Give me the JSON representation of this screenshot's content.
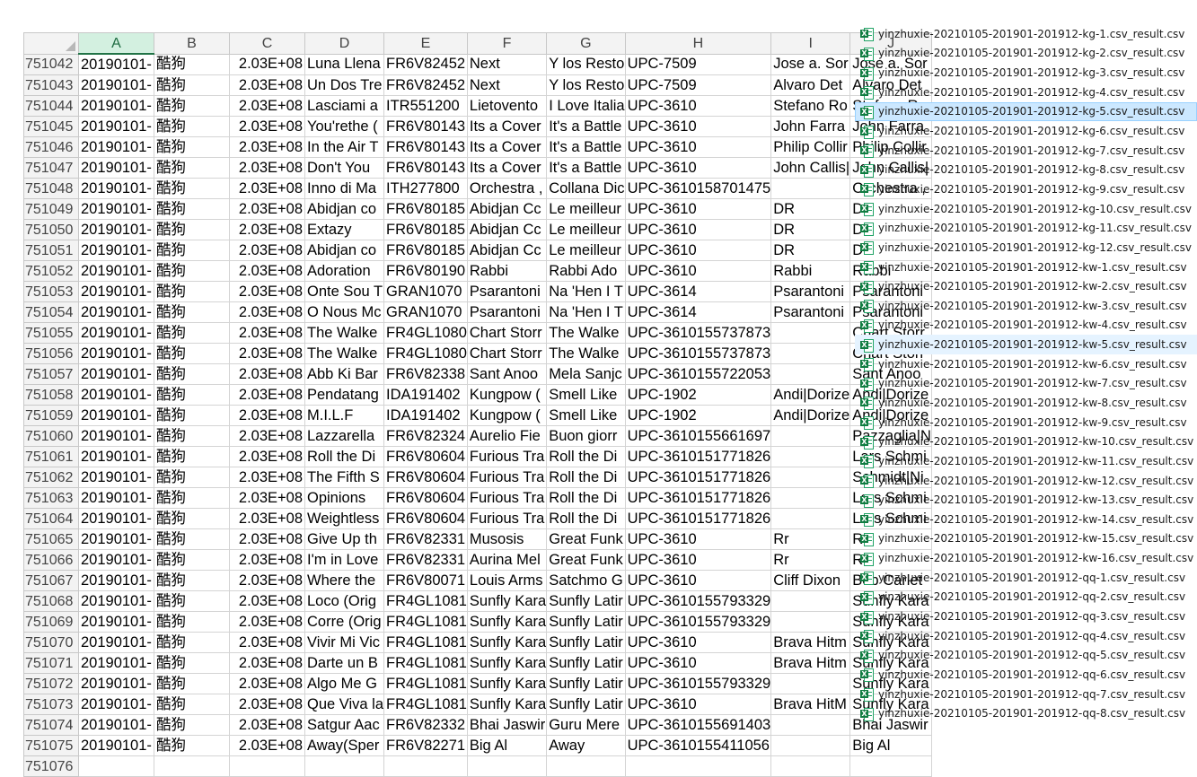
{
  "spreadsheet": {
    "columns": [
      "A",
      "B",
      "C",
      "D",
      "E",
      "F",
      "G",
      "H",
      "I",
      "J"
    ],
    "selected_column": "A",
    "rows": [
      {
        "n": "751042",
        "a": "20190101-",
        "b": "酷狗",
        "c": "2.03E+08",
        "d": "Luna Llena",
        "e": "FR6V82452",
        "f": "Next",
        "g": "Y los Resto",
        "h": "UPC-7509",
        "i": "Jose a. Sor",
        "j": "Jose a. Sor"
      },
      {
        "n": "751043",
        "a": "20190101-",
        "b": "酷狗",
        "c": "2.03E+08",
        "d": "Un Dos Tre",
        "e": "FR6V82452",
        "f": "Next",
        "g": "Y los Resto",
        "h": "UPC-7509",
        "i": "Alvaro Det",
        "j": "Alvaro Det"
      },
      {
        "n": "751044",
        "a": "20190101-",
        "b": "酷狗",
        "c": "2.03E+08",
        "d": "Lasciami a",
        "e": "ITR551200",
        "f": "Lietovento",
        "g": "I Love Italia",
        "h": "UPC-3610",
        "i": "Stefano Ro",
        "j": "Stefano Ro"
      },
      {
        "n": "751045",
        "a": "20190101-",
        "b": "酷狗",
        "c": "2.03E+08",
        "d": "You'rethe (",
        "e": "FR6V80143",
        "f": "Its a Cover",
        "g": "It's a Battle",
        "h": "UPC-3610",
        "i": "John Farra",
        "j": "John Farra"
      },
      {
        "n": "751046",
        "a": "20190101-",
        "b": "酷狗",
        "c": "2.03E+08",
        "d": "In the Air T",
        "e": "FR6V80143",
        "f": "Its a Cover",
        "g": "It's a Battle",
        "h": "UPC-3610",
        "i": "Philip Collir",
        "j": "Philip Collir"
      },
      {
        "n": "751047",
        "a": "20190101-",
        "b": "酷狗",
        "c": "2.03E+08",
        "d": "Don't You",
        "e": "FR6V80143",
        "f": "Its a Cover",
        "g": "It's a Battle",
        "h": "UPC-3610",
        "i": "John Callis|",
        "j": "John Callis|"
      },
      {
        "n": "751048",
        "a": "20190101-",
        "b": "酷狗",
        "c": "2.03E+08",
        "d": "Inno di Ma",
        "e": "ITH277800",
        "f": "Orchestra ,",
        "g": "Collana Dic",
        "h": "UPC-3610158701475",
        "i": "",
        "j": "Orchestra ,"
      },
      {
        "n": "751049",
        "a": "20190101-",
        "b": "酷狗",
        "c": "2.03E+08",
        "d": "Abidjan co",
        "e": "FR6V80185",
        "f": "Abidjan Cc",
        "g": "Le meilleur",
        "h": "UPC-3610",
        "i": "DR",
        "j": "DR"
      },
      {
        "n": "751050",
        "a": "20190101-",
        "b": "酷狗",
        "c": "2.03E+08",
        "d": "Extazy",
        "e": "FR6V80185",
        "f": "Abidjan Cc",
        "g": "Le meilleur",
        "h": "UPC-3610",
        "i": "DR",
        "j": "DR"
      },
      {
        "n": "751051",
        "a": "20190101-",
        "b": "酷狗",
        "c": "2.03E+08",
        "d": "Abidjan co",
        "e": "FR6V80185",
        "f": "Abidjan Cc",
        "g": "Le meilleur",
        "h": "UPC-3610",
        "i": "DR",
        "j": "DR"
      },
      {
        "n": "751052",
        "a": "20190101-",
        "b": "酷狗",
        "c": "2.03E+08",
        "d": "Adoration",
        "e": "FR6V80190",
        "f": "Rabbi",
        "g": "Rabbi Ado",
        "h": "UPC-3610",
        "i": "Rabbi",
        "j": "Rabbi"
      },
      {
        "n": "751053",
        "a": "20190101-",
        "b": "酷狗",
        "c": "2.03E+08",
        "d": "Onte Sou T",
        "e": "GRAN1070",
        "f": "Psarantoni",
        "g": "Na 'Hen I T",
        "h": "UPC-3614",
        "i": "Psarantoni",
        "j": "Psarantoni"
      },
      {
        "n": "751054",
        "a": "20190101-",
        "b": "酷狗",
        "c": "2.03E+08",
        "d": "O Nous Mc",
        "e": "GRAN1070",
        "f": "Psarantoni",
        "g": "Na 'Hen I T",
        "h": "UPC-3614",
        "i": "Psarantoni",
        "j": "Psarantoni"
      },
      {
        "n": "751055",
        "a": "20190101-",
        "b": "酷狗",
        "c": "2.03E+08",
        "d": "The Walke",
        "e": "FR4GL1080",
        "f": "Chart Storr",
        "g": "The Walke",
        "h": "UPC-3610155737873",
        "i": "",
        "j": "Chart Storr"
      },
      {
        "n": "751056",
        "a": "20190101-",
        "b": "酷狗",
        "c": "2.03E+08",
        "d": "The Walke",
        "e": "FR4GL1080",
        "f": "Chart Storr",
        "g": "The Walke",
        "h": "UPC-3610155737873",
        "i": "",
        "j": "Chart Storr"
      },
      {
        "n": "751057",
        "a": "20190101-",
        "b": "酷狗",
        "c": "2.03E+08",
        "d": "Abb Ki Bar",
        "e": "FR6V82338",
        "f": "Sant Anoo",
        "g": "Mela Sanjc",
        "h": "UPC-3610155722053",
        "i": "",
        "j": "Sant Anoo"
      },
      {
        "n": "751058",
        "a": "20190101-",
        "b": "酷狗",
        "c": "2.03E+08",
        "d": "Pendatang",
        "e": "IDA191402",
        "f": "Kungpow (",
        "g": "Smell Like",
        "h": "UPC-1902",
        "i": "Andi|Dorize",
        "j": "Andi|Dorize"
      },
      {
        "n": "751059",
        "a": "20190101-",
        "b": "酷狗",
        "c": "2.03E+08",
        "d": "M.I.L.F",
        "e": "IDA191402",
        "f": "Kungpow (",
        "g": "Smell Like",
        "h": "UPC-1902",
        "i": "Andi|Dorize",
        "j": "Andi|Dorize"
      },
      {
        "n": "751060",
        "a": "20190101-",
        "b": "酷狗",
        "c": "2.03E+08",
        "d": "Lazzarella",
        "e": "FR6V82324",
        "f": "Aurelio Fie",
        "g": "Buon giorr",
        "h": "UPC-3610155661697",
        "i": "",
        "j": "Pazzaglia|N"
      },
      {
        "n": "751061",
        "a": "20190101-",
        "b": "酷狗",
        "c": "2.03E+08",
        "d": "Roll the Di",
        "e": "FR6V80604",
        "f": "Furious Tra",
        "g": "Roll the Di",
        "h": "UPC-3610151771826",
        "i": "",
        "j": "Lars Schmi"
      },
      {
        "n": "751062",
        "a": "20190101-",
        "b": "酷狗",
        "c": "2.03E+08",
        "d": "The Fifth S",
        "e": "FR6V80604",
        "f": "Furious Tra",
        "g": "Roll the Di",
        "h": "UPC-3610151771826",
        "i": "",
        "j": "Schmidt|Ni"
      },
      {
        "n": "751063",
        "a": "20190101-",
        "b": "酷狗",
        "c": "2.03E+08",
        "d": "Opinions",
        "e": "FR6V80604",
        "f": "Furious Tra",
        "g": "Roll the Di",
        "h": "UPC-3610151771826",
        "i": "",
        "j": "Lars Schmi"
      },
      {
        "n": "751064",
        "a": "20190101-",
        "b": "酷狗",
        "c": "2.03E+08",
        "d": "Weightless",
        "e": "FR6V80604",
        "f": "Furious Tra",
        "g": "Roll the Di",
        "h": "UPC-3610151771826",
        "i": "",
        "j": "Lars Schmi"
      },
      {
        "n": "751065",
        "a": "20190101-",
        "b": "酷狗",
        "c": "2.03E+08",
        "d": "Give Up th",
        "e": "FR6V82331",
        "f": "Musosis",
        "g": "Great Funk",
        "h": "UPC-3610",
        "i": "Rr",
        "j": "Rr"
      },
      {
        "n": "751066",
        "a": "20190101-",
        "b": "酷狗",
        "c": "2.03E+08",
        "d": "I'm in Love",
        "e": "FR6V82331",
        "f": "Aurina Mel",
        "g": "Great Funk",
        "h": "UPC-3610",
        "i": "Rr",
        "j": "Rr"
      },
      {
        "n": "751067",
        "a": "20190101-",
        "b": "酷狗",
        "c": "2.03E+08",
        "d": "Where the",
        "e": "FR6V80071",
        "f": "Louis Arms",
        "g": "Satchmo G",
        "h": "UPC-3610",
        "i": "Cliff Dixon",
        "j": "Bob Carlet"
      },
      {
        "n": "751068",
        "a": "20190101-",
        "b": "酷狗",
        "c": "2.03E+08",
        "d": "Loco (Orig",
        "e": "FR4GL1081",
        "f": "Sunfly Kara",
        "g": "Sunfly Latir",
        "h": "UPC-3610155793329",
        "i": "",
        "j": "Sunfly Kara"
      },
      {
        "n": "751069",
        "a": "20190101-",
        "b": "酷狗",
        "c": "2.03E+08",
        "d": "Corre (Orig",
        "e": "FR4GL1081",
        "f": "Sunfly Kara",
        "g": "Sunfly Latir",
        "h": "UPC-3610155793329",
        "i": "",
        "j": "Sunfly Kara"
      },
      {
        "n": "751070",
        "a": "20190101-",
        "b": "酷狗",
        "c": "2.03E+08",
        "d": "Vivir Mi Vic",
        "e": "FR4GL1081",
        "f": "Sunfly Kara",
        "g": "Sunfly Latir",
        "h": "UPC-3610",
        "i": "Brava Hitm",
        "j": "Sunfly Kara"
      },
      {
        "n": "751071",
        "a": "20190101-",
        "b": "酷狗",
        "c": "2.03E+08",
        "d": "Darte un B",
        "e": "FR4GL1081",
        "f": "Sunfly Kara",
        "g": "Sunfly Latir",
        "h": "UPC-3610",
        "i": "Brava Hitm",
        "j": "Sunfly Kara"
      },
      {
        "n": "751072",
        "a": "20190101-",
        "b": "酷狗",
        "c": "2.03E+08",
        "d": "Algo Me G",
        "e": "FR4GL1081",
        "f": "Sunfly Kara",
        "g": "Sunfly Latir",
        "h": "UPC-3610155793329",
        "i": "",
        "j": "Sunfly Kara"
      },
      {
        "n": "751073",
        "a": "20190101-",
        "b": "酷狗",
        "c": "2.03E+08",
        "d": "Que Viva la",
        "e": "FR4GL1081",
        "f": "Sunfly Kara",
        "g": "Sunfly Latir",
        "h": "UPC-3610",
        "i": "Brava HitM",
        "j": "Sunfly Kara"
      },
      {
        "n": "751074",
        "a": "20190101-",
        "b": "酷狗",
        "c": "2.03E+08",
        "d": "Satgur Aac",
        "e": "FR6V82332",
        "f": "Bhai Jaswir",
        "g": "Guru Mere",
        "h": "UPC-3610155691403",
        "i": "",
        "j": "Bhai Jaswir"
      },
      {
        "n": "751075",
        "a": "20190101-",
        "b": "酷狗",
        "c": "2.03E+08",
        "d": "Away(Sper",
        "e": "FR6V82271",
        "f": "Big Al",
        "g": "Away",
        "h": "UPC-3610155411056",
        "i": "",
        "j": "Big Al"
      },
      {
        "n": "751076",
        "a": "",
        "b": "",
        "c": "",
        "d": "",
        "e": "",
        "f": "",
        "g": "",
        "h": "",
        "i": "",
        "j": ""
      }
    ]
  },
  "file_list": {
    "icon": "excel-csv-icon",
    "files": [
      {
        "name": "yinzhuxie-20210105-201901-201912-kg-1.csv_result.csv",
        "state": "normal"
      },
      {
        "name": "yinzhuxie-20210105-201901-201912-kg-2.csv_result.csv",
        "state": "normal"
      },
      {
        "name": "yinzhuxie-20210105-201901-201912-kg-3.csv_result.csv",
        "state": "normal"
      },
      {
        "name": "yinzhuxie-20210105-201901-201912-kg-4.csv_result.csv",
        "state": "normal"
      },
      {
        "name": "yinzhuxie-20210105-201901-201912-kg-5.csv_result.csv",
        "state": "selected"
      },
      {
        "name": "yinzhuxie-20210105-201901-201912-kg-6.csv_result.csv",
        "state": "normal"
      },
      {
        "name": "yinzhuxie-20210105-201901-201912-kg-7.csv_result.csv",
        "state": "normal"
      },
      {
        "name": "yinzhuxie-20210105-201901-201912-kg-8.csv_result.csv",
        "state": "normal"
      },
      {
        "name": "yinzhuxie-20210105-201901-201912-kg-9.csv_result.csv",
        "state": "normal"
      },
      {
        "name": "yinzhuxie-20210105-201901-201912-kg-10.csv_result.csv",
        "state": "normal"
      },
      {
        "name": "yinzhuxie-20210105-201901-201912-kg-11.csv_result.csv",
        "state": "normal"
      },
      {
        "name": "yinzhuxie-20210105-201901-201912-kg-12.csv_result.csv",
        "state": "normal"
      },
      {
        "name": "yinzhuxie-20210105-201901-201912-kw-1.csv_result.csv",
        "state": "normal"
      },
      {
        "name": "yinzhuxie-20210105-201901-201912-kw-2.csv_result.csv",
        "state": "normal"
      },
      {
        "name": "yinzhuxie-20210105-201901-201912-kw-3.csv_result.csv",
        "state": "normal"
      },
      {
        "name": "yinzhuxie-20210105-201901-201912-kw-4.csv_result.csv",
        "state": "normal"
      },
      {
        "name": "yinzhuxie-20210105-201901-201912-kw-5.csv_result.csv",
        "state": "hover"
      },
      {
        "name": "yinzhuxie-20210105-201901-201912-kw-6.csv_result.csv",
        "state": "normal"
      },
      {
        "name": "yinzhuxie-20210105-201901-201912-kw-7.csv_result.csv",
        "state": "normal"
      },
      {
        "name": "yinzhuxie-20210105-201901-201912-kw-8.csv_result.csv",
        "state": "normal"
      },
      {
        "name": "yinzhuxie-20210105-201901-201912-kw-9.csv_result.csv",
        "state": "normal"
      },
      {
        "name": "yinzhuxie-20210105-201901-201912-kw-10.csv_result.csv",
        "state": "normal"
      },
      {
        "name": "yinzhuxie-20210105-201901-201912-kw-11.csv_result.csv",
        "state": "normal"
      },
      {
        "name": "yinzhuxie-20210105-201901-201912-kw-12.csv_result.csv",
        "state": "normal"
      },
      {
        "name": "yinzhuxie-20210105-201901-201912-kw-13.csv_result.csv",
        "state": "normal"
      },
      {
        "name": "yinzhuxie-20210105-201901-201912-kw-14.csv_result.csv",
        "state": "normal"
      },
      {
        "name": "yinzhuxie-20210105-201901-201912-kw-15.csv_result.csv",
        "state": "normal"
      },
      {
        "name": "yinzhuxie-20210105-201901-201912-kw-16.csv_result.csv",
        "state": "normal"
      },
      {
        "name": "yinzhuxie-20210105-201901-201912-qq-1.csv_result.csv",
        "state": "normal"
      },
      {
        "name": "yinzhuxie-20210105-201901-201912-qq-2.csv_result.csv",
        "state": "normal"
      },
      {
        "name": "yinzhuxie-20210105-201901-201912-qq-3.csv_result.csv",
        "state": "normal"
      },
      {
        "name": "yinzhuxie-20210105-201901-201912-qq-4.csv_result.csv",
        "state": "normal"
      },
      {
        "name": "yinzhuxie-20210105-201901-201912-qq-5.csv_result.csv",
        "state": "normal"
      },
      {
        "name": "yinzhuxie-20210105-201901-201912-qq-6.csv_result.csv",
        "state": "normal"
      },
      {
        "name": "yinzhuxie-20210105-201901-201912-qq-7.csv_result.csv",
        "state": "normal"
      },
      {
        "name": "yinzhuxie-20210105-201901-201912-qq-8.csv_result.csv",
        "state": "normal"
      }
    ]
  },
  "colors": {
    "header_bg": "#f3f3f3",
    "selected_header_bg": "#d3f0e0",
    "excel_green": "#107c41",
    "selection_bg": "#cce8ff",
    "hover_bg": "#e5f3ff"
  }
}
